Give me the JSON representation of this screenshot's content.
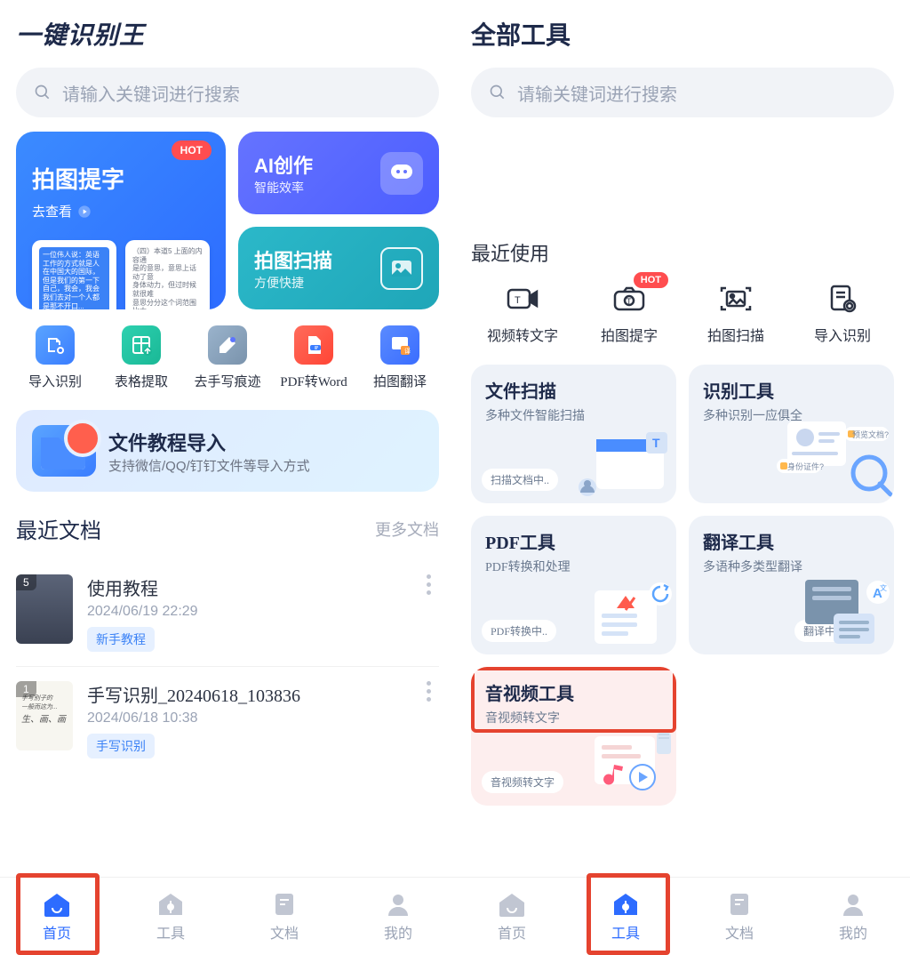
{
  "left": {
    "appTitle": "一键识别王",
    "searchPlaceholder": "请输入关键词进行搜索",
    "heroMain": {
      "title": "拍图提字",
      "cta": "去查看",
      "hot": "HOT"
    },
    "heroAI": {
      "title": "AI创作",
      "subtitle": "智能效率"
    },
    "heroScan": {
      "title": "拍图扫描",
      "subtitle": "方便快捷"
    },
    "tools": [
      {
        "label": "导入识别"
      },
      {
        "label": "表格提取"
      },
      {
        "label": "去手写痕迹"
      },
      {
        "label": "PDF转Word"
      },
      {
        "label": "拍图翻译"
      }
    ],
    "banner": {
      "title": "文件教程导入",
      "subtitle": "支持微信/QQ/钉钉文件等导入方式"
    },
    "recentDocs": {
      "title": "最近文档",
      "more": "更多文档",
      "items": [
        {
          "title": "使用教程",
          "date": "2024/06/19 22:29",
          "tag": "新手教程",
          "count": "5"
        },
        {
          "title": "手写识别_20240618_103836",
          "date": "2024/06/18 10:38",
          "tag": "手写识别",
          "count": "1"
        }
      ]
    },
    "nav": [
      {
        "label": "首页"
      },
      {
        "label": "工具"
      },
      {
        "label": "文档"
      },
      {
        "label": "我的"
      }
    ]
  },
  "right": {
    "screenTitle": "全部工具",
    "searchPlaceholder": "请输关键词进行搜索",
    "recentTitle": "最近使用",
    "hot": "HOT",
    "recent": [
      {
        "label": "视频转文字"
      },
      {
        "label": "拍图提字"
      },
      {
        "label": "拍图扫描"
      },
      {
        "label": "导入识别"
      }
    ],
    "categories": [
      {
        "title": "文件扫描",
        "subtitle": "多种文件智能扫描",
        "pill": "扫描文档中.."
      },
      {
        "title": "识别工具",
        "subtitle": "多种识别一应俱全",
        "pill": ""
      },
      {
        "title": "PDF工具",
        "subtitle": "PDF转换和处理",
        "pill": "PDF转换中.."
      },
      {
        "title": "翻译工具",
        "subtitle": "多语种多类型翻译",
        "pill": "翻译中.."
      },
      {
        "title": "音视频工具",
        "subtitle": "音视频转文字",
        "pill": "音视频转文字"
      }
    ],
    "catPillRight1a": "预览文档?",
    "catPillRight1b": "身份证件?",
    "nav": [
      {
        "label": "首页"
      },
      {
        "label": "工具"
      },
      {
        "label": "文档"
      },
      {
        "label": "我的"
      }
    ]
  }
}
